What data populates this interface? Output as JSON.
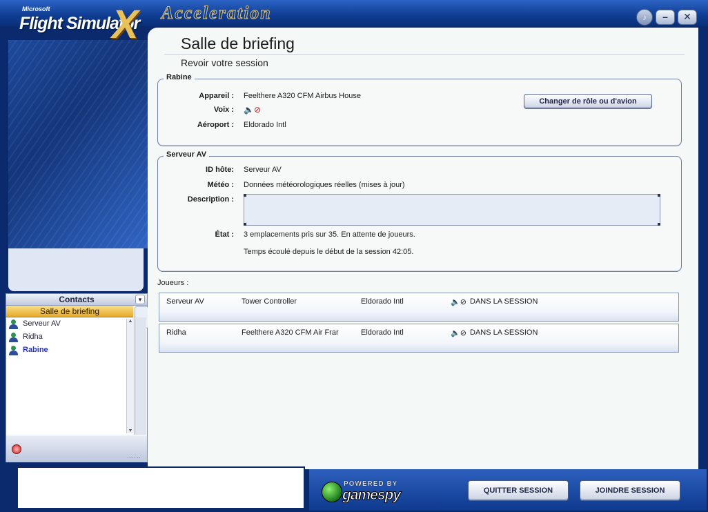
{
  "app": {
    "logo_ms": "Microsoft",
    "logo_name": "Flight Simulator",
    "logo_x": "X",
    "logo_edition": "Acceleration",
    "window_buttons": {
      "sound": "sound-icon",
      "minimize": "–",
      "close": "✕"
    }
  },
  "page": {
    "title": "Salle de briefing",
    "subtitle": "Revoir votre session"
  },
  "player_box": {
    "title": "Rabine",
    "fields": {
      "aircraft_label": "Appareil :",
      "aircraft_value": "Feelthere A320 CFM Airbus House",
      "voice_label": "Voix :",
      "voice_icon": "🔈⊘",
      "airport_label": "Aéroport :",
      "airport_value": "Eldorado Intl"
    },
    "change_button": "Changer de rôle ou d'avion"
  },
  "server_box": {
    "title": "Serveur AV",
    "host_label": "ID hôte:",
    "host_value": "Serveur AV",
    "weather_label": "Météo :",
    "weather_value": "Données météorologiques réelles (mises à jour)",
    "description_label": "Description :",
    "description_value": "",
    "status_label": "État :",
    "status_value": "3 emplacements pris sur 35. En attente de joueurs.",
    "elapsed_value": "Temps écoulé depuis le début de la session 42:05."
  },
  "players": {
    "label": "Joueurs :",
    "rows": [
      {
        "name": "Serveur AV",
        "aircraft": "Tower Controller",
        "airport": "Eldorado Intl",
        "voice": "🔈⊘",
        "status": "DANS LA SESSION"
      },
      {
        "name": "Ridha",
        "aircraft": "Feelthere A320 CFM Air Frar",
        "airport": "Eldorado Intl",
        "voice": "🔈⊘",
        "status": "DANS LA SESSION"
      }
    ]
  },
  "contacts": {
    "header": "Contacts",
    "group": "Salle de briefing",
    "items": [
      {
        "name": "Serveur AV"
      },
      {
        "name": "Ridha"
      },
      {
        "name": "Rabine"
      }
    ],
    "scroll_up": "▲",
    "scroll_down": "▼"
  },
  "bottom": {
    "powered_by": "POWERED BY",
    "gamespy": "gamespy",
    "quit_button": "QUITTER SESSION",
    "join_button": "JOINDRE SESSION"
  },
  "colors": {
    "frame_blue": "#0b2a6e",
    "voice_red": "#c01818",
    "group_highlight": "#e6a92a",
    "active_contact": "#2734b7"
  }
}
